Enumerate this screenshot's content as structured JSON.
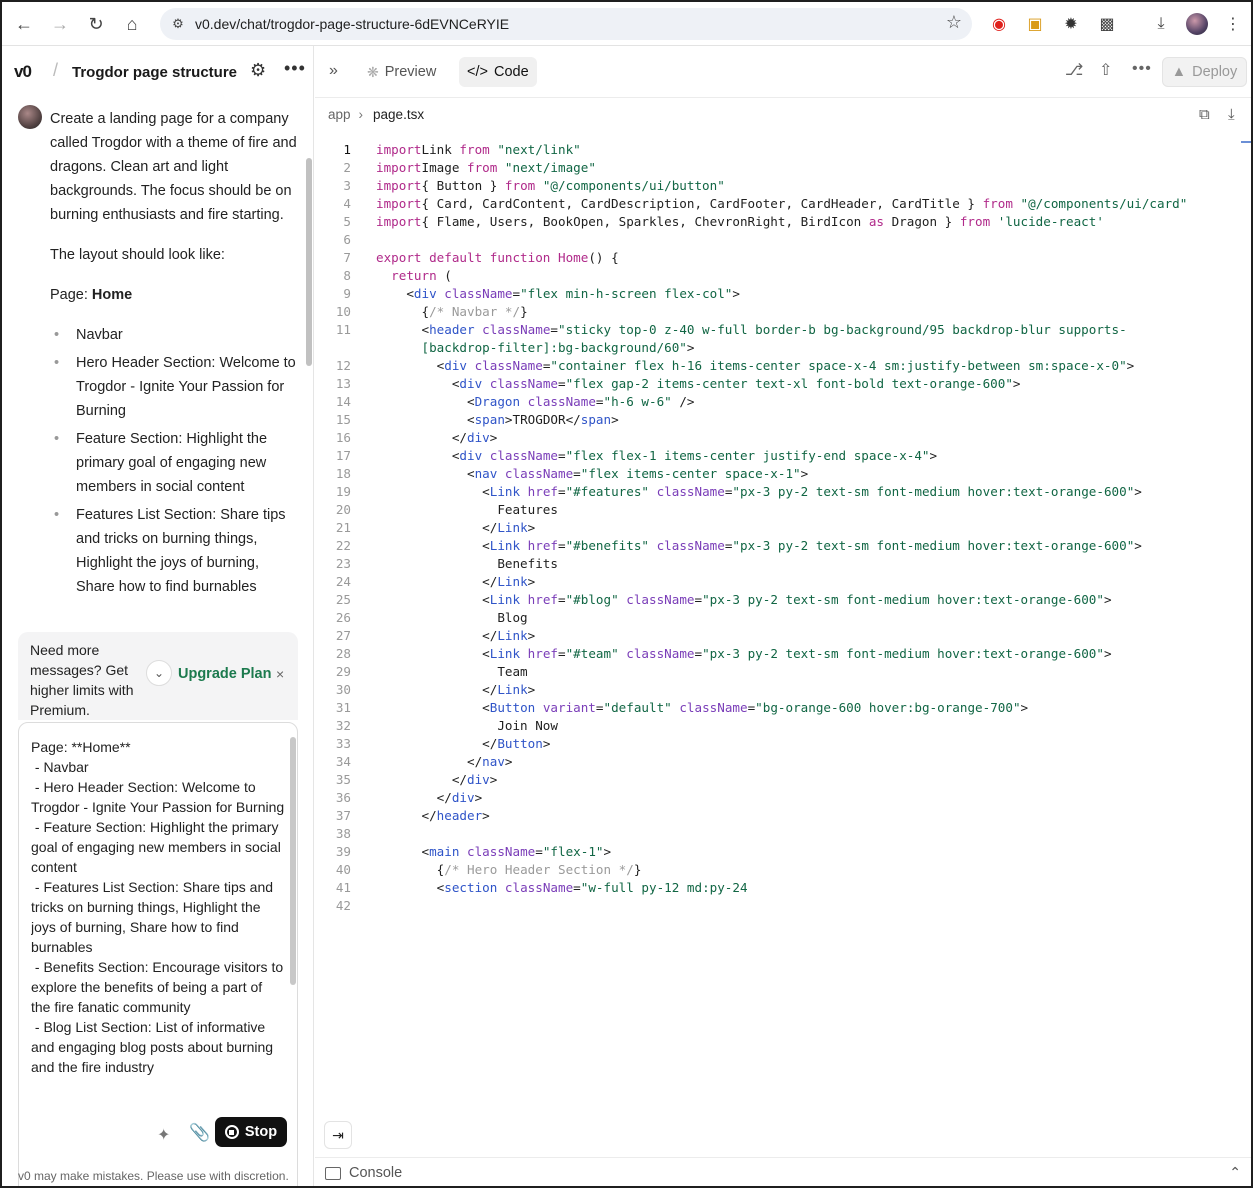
{
  "browser": {
    "url": "v0.dev/chat/trogdor-page-structure-6dEVNCeRYIE"
  },
  "sidebar": {
    "logo": "v0",
    "chat_title": "Trogdor page structure",
    "message": {
      "p1": "Create a landing page for a company called Trogdor with a theme of fire and dragons. Clean art and light backgrounds. The focus should be on burning enthusiasts and fire starting.",
      "p2": "The layout should look like:",
      "page_label": "Page: ",
      "page_name": "Home",
      "items": [
        "Navbar",
        "Hero Header Section: Welcome to Trogdor - Ignite Your Passion for Burning",
        "Feature Section: Highlight the primary goal of engaging new members in social content",
        "Features List Section: Share tips and tricks on burning things, Highlight the joys of burning, Share how to find burnables"
      ]
    },
    "upsell": {
      "text": "Need more messages? Get higher limits with Premium.",
      "upgrade_label": "Upgrade Plan",
      "close": "×"
    },
    "composer": {
      "text": "Page: **Home**\n - Navbar\n - Hero Header Section: Welcome to Trogdor - Ignite Your Passion for Burning\n - Feature Section: Highlight the primary goal of engaging new members in social content\n - Features List Section: Share tips and tricks on burning things, Highlight the joys of burning, Share how to find burnables\n - Benefits Section: Encourage visitors to explore the benefits of being a part of the fire fanatic community\n - Blog List Section: List of informative and engaging blog posts about burning and the fire industry",
      "stop_label": "Stop"
    },
    "disclaimer": "v0 may make mistakes. Please use with discretion."
  },
  "main": {
    "tabs": {
      "preview": "Preview",
      "code": "Code"
    },
    "deploy_label": "Deploy",
    "breadcrumb": {
      "folder": "app",
      "file": "page.tsx"
    },
    "console_label": "Console",
    "code_lines": [
      [
        [
          "kw",
          "import"
        ],
        [
          "",
          "Link "
        ],
        [
          "kw",
          "from"
        ],
        [
          "",
          ""
        ],
        [
          "str",
          " \"next/link\""
        ]
      ],
      [
        [
          "kw",
          "import"
        ],
        [
          "",
          "Image "
        ],
        [
          "kw",
          "from"
        ],
        [
          "str",
          " \"next/image\""
        ]
      ],
      [
        [
          "kw",
          "import"
        ],
        [
          "",
          "{ Button } "
        ],
        [
          "kw",
          "from"
        ],
        [
          "str",
          " \"@/components/ui/button\""
        ]
      ],
      [
        [
          "kw",
          "import"
        ],
        [
          "",
          "{ Card, CardContent, CardDescription, CardFooter, CardHeader, CardTitle } "
        ],
        [
          "kw",
          "from"
        ],
        [
          "str",
          " \"@/components/ui/card\""
        ]
      ],
      [
        [
          "kw",
          "import"
        ],
        [
          "",
          "{ Flame, Users, BookOpen, Sparkles, ChevronRight, BirdIcon "
        ],
        [
          "kw",
          "as"
        ],
        [
          "",
          " Dragon } "
        ],
        [
          "kw",
          "from"
        ],
        [
          "str",
          " 'lucide-react'"
        ]
      ],
      [],
      [
        [
          "kw",
          "export default function "
        ],
        [
          "fn",
          "Home"
        ],
        [
          "",
          "() {"
        ]
      ],
      [
        [
          "",
          "  "
        ],
        [
          "kw",
          "return"
        ],
        [
          "",
          " ("
        ]
      ],
      [
        [
          "",
          "    <"
        ],
        [
          "tag",
          "div"
        ],
        [
          "attr",
          " className"
        ],
        [
          "",
          "="
        ],
        [
          "str",
          "\"flex min-h-screen flex-col\""
        ],
        [
          "",
          ">"
        ]
      ],
      [
        [
          "",
          "      {"
        ],
        [
          "cmt",
          "/* Navbar */"
        ],
        [
          "",
          "}"
        ]
      ],
      [
        [
          "",
          "      <"
        ],
        [
          "tag",
          "header"
        ],
        [
          "attr",
          " className"
        ],
        [
          "",
          "="
        ],
        [
          "str",
          "\"sticky top-0 z-40 w-full border-b bg-background/95 backdrop-blur supports-"
        ]
      ],
      [
        [
          "str",
          "      [backdrop-filter]:bg-background/60\""
        ],
        [
          "",
          ">"
        ]
      ],
      [
        [
          "",
          "        <"
        ],
        [
          "tag",
          "div"
        ],
        [
          "attr",
          " className"
        ],
        [
          "",
          "="
        ],
        [
          "str",
          "\"container flex h-16 items-center space-x-4 sm:justify-between sm:space-x-0\""
        ],
        [
          "",
          ">"
        ]
      ],
      [
        [
          "",
          "          <"
        ],
        [
          "tag",
          "div"
        ],
        [
          "attr",
          " className"
        ],
        [
          "",
          "="
        ],
        [
          "str",
          "\"flex gap-2 items-center text-xl font-bold text-orange-600\""
        ],
        [
          "",
          ">"
        ]
      ],
      [
        [
          "",
          "            <"
        ],
        [
          "tag",
          "Dragon"
        ],
        [
          "attr",
          " className"
        ],
        [
          "",
          "="
        ],
        [
          "str",
          "\"h-6 w-6\""
        ],
        [
          "",
          " />"
        ]
      ],
      [
        [
          "",
          "            <"
        ],
        [
          "tag",
          "span"
        ],
        [
          "",
          "&gt;TROGDOR&lt;/"
        ],
        [
          "tag",
          "span"
        ],
        [
          "",
          ">"
        ]
      ],
      [
        [
          "",
          "          </"
        ],
        [
          "tag",
          "div"
        ],
        [
          "",
          ">"
        ]
      ],
      [
        [
          "",
          "          <"
        ],
        [
          "tag",
          "div"
        ],
        [
          "attr",
          " className"
        ],
        [
          "",
          "="
        ],
        [
          "str",
          "\"flex flex-1 items-center justify-end space-x-4\""
        ],
        [
          "",
          ">"
        ]
      ],
      [
        [
          "",
          "            <"
        ],
        [
          "tag",
          "nav"
        ],
        [
          "attr",
          " className"
        ],
        [
          "",
          "="
        ],
        [
          "str",
          "\"flex items-center space-x-1\""
        ],
        [
          "",
          ">"
        ]
      ],
      [
        [
          "",
          "              <"
        ],
        [
          "tag",
          "Link"
        ],
        [
          "attr",
          " href"
        ],
        [
          "",
          "="
        ],
        [
          "str",
          "\"#features\""
        ],
        [
          "attr",
          " className"
        ],
        [
          "",
          "="
        ],
        [
          "str",
          "\"px-3 py-2 text-sm font-medium hover:text-orange-600\""
        ],
        [
          "",
          ">"
        ]
      ],
      [
        [
          "",
          "                Features"
        ]
      ],
      [
        [
          "",
          "              </"
        ],
        [
          "tag",
          "Link"
        ],
        [
          "",
          ">"
        ]
      ],
      [
        [
          "",
          "              <"
        ],
        [
          "tag",
          "Link"
        ],
        [
          "attr",
          " href"
        ],
        [
          "",
          "="
        ],
        [
          "str",
          "\"#benefits\""
        ],
        [
          "attr",
          " className"
        ],
        [
          "",
          "="
        ],
        [
          "str",
          "\"px-3 py-2 text-sm font-medium hover:text-orange-600\""
        ],
        [
          "",
          ">"
        ]
      ],
      [
        [
          "",
          "                Benefits"
        ]
      ],
      [
        [
          "",
          "              </"
        ],
        [
          "tag",
          "Link"
        ],
        [
          "",
          ">"
        ]
      ],
      [
        [
          "",
          "              <"
        ],
        [
          "tag",
          "Link"
        ],
        [
          "attr",
          " href"
        ],
        [
          "",
          "="
        ],
        [
          "str",
          "\"#blog\""
        ],
        [
          "attr",
          " className"
        ],
        [
          "",
          "="
        ],
        [
          "str",
          "\"px-3 py-2 text-sm font-medium hover:text-orange-600\""
        ],
        [
          "",
          ">"
        ]
      ],
      [
        [
          "",
          "                Blog"
        ]
      ],
      [
        [
          "",
          "              </"
        ],
        [
          "tag",
          "Link"
        ],
        [
          "",
          ">"
        ]
      ],
      [
        [
          "",
          "              <"
        ],
        [
          "tag",
          "Link"
        ],
        [
          "attr",
          " href"
        ],
        [
          "",
          "="
        ],
        [
          "str",
          "\"#team\""
        ],
        [
          "attr",
          " className"
        ],
        [
          "",
          "="
        ],
        [
          "str",
          "\"px-3 py-2 text-sm font-medium hover:text-orange-600\""
        ],
        [
          "",
          ">"
        ]
      ],
      [
        [
          "",
          "                Team"
        ]
      ],
      [
        [
          "",
          "              </"
        ],
        [
          "tag",
          "Link"
        ],
        [
          "",
          ">"
        ]
      ],
      [
        [
          "",
          "              <"
        ],
        [
          "tag",
          "Button"
        ],
        [
          "attr",
          " variant"
        ],
        [
          "",
          "="
        ],
        [
          "str",
          "\"default\""
        ],
        [
          "attr",
          " className"
        ],
        [
          "",
          "="
        ],
        [
          "str",
          "\"bg-orange-600 hover:bg-orange-700\""
        ],
        [
          "",
          ">"
        ]
      ],
      [
        [
          "",
          "                Join Now"
        ]
      ],
      [
        [
          "",
          "              </"
        ],
        [
          "tag",
          "Button"
        ],
        [
          "",
          ">"
        ]
      ],
      [
        [
          "",
          "            </"
        ],
        [
          "tag",
          "nav"
        ],
        [
          "",
          ">"
        ]
      ],
      [
        [
          "",
          "          </"
        ],
        [
          "tag",
          "div"
        ],
        [
          "",
          ">"
        ]
      ],
      [
        [
          "",
          "        </"
        ],
        [
          "tag",
          "div"
        ],
        [
          "",
          ">"
        ]
      ],
      [
        [
          "",
          "      </"
        ],
        [
          "tag",
          "header"
        ],
        [
          "",
          ">"
        ]
      ],
      [],
      [
        [
          "",
          "      <"
        ],
        [
          "tag",
          "main"
        ],
        [
          "attr",
          " className"
        ],
        [
          "",
          "="
        ],
        [
          "str",
          "\"flex-1\""
        ],
        [
          "",
          ">"
        ]
      ],
      [
        [
          "",
          "        {"
        ],
        [
          "cmt",
          "/* Hero Header Section */"
        ],
        [
          "",
          "}"
        ]
      ],
      [
        [
          "",
          "        <"
        ],
        [
          "tag",
          "section"
        ],
        [
          "attr",
          " className"
        ],
        [
          "",
          "="
        ],
        [
          "str",
          "\"w-full py-12 md:py-24"
        ]
      ],
      []
    ],
    "line_numbers": [
      "1",
      "2",
      "3",
      "4",
      "5",
      "6",
      "7",
      "8",
      "9",
      "10",
      "11",
      "",
      "12",
      "13",
      "14",
      "15",
      "16",
      "17",
      "18",
      "19",
      "20",
      "21",
      "22",
      "23",
      "24",
      "25",
      "26",
      "27",
      "28",
      "29",
      "30",
      "31",
      "32",
      "33",
      "34",
      "35",
      "36",
      "37",
      "38",
      "39",
      "40",
      "41",
      "42"
    ]
  }
}
